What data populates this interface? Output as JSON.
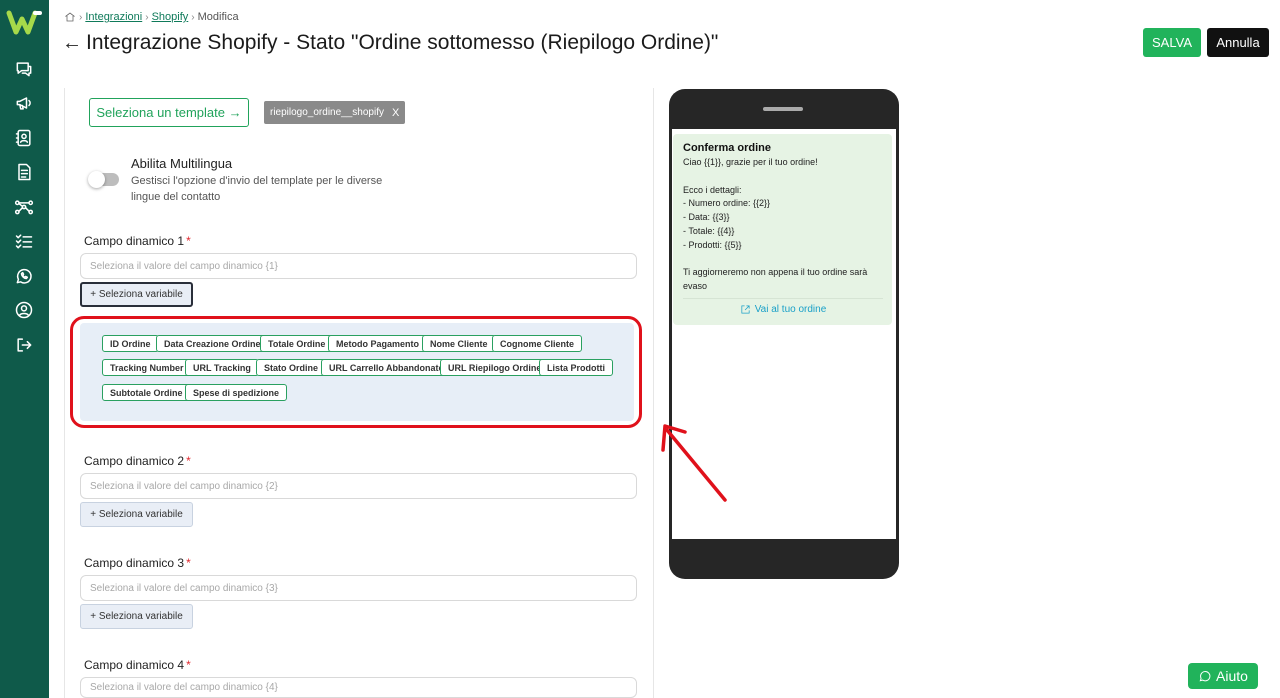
{
  "breadcrumb": {
    "items": [
      "Integrazioni",
      "Shopify",
      "Modifica"
    ]
  },
  "header": {
    "title": "Integrazione Shopify - Stato \"Ordine sottomesso (Riepilogo Ordine)\"",
    "back_glyph": "←",
    "save_label": "SALVA",
    "cancel_label": "Annulla"
  },
  "sidebar": {
    "icons": [
      "chat-icon",
      "megaphone-icon",
      "contacts-icon",
      "document-icon",
      "flow-icon",
      "checklist-icon",
      "whatsapp-icon",
      "user-icon",
      "logout-icon"
    ]
  },
  "template": {
    "select_label": "Seleziona un template",
    "arrow_glyph": "→",
    "selected_name": "riepilogo_ordine__shopify",
    "remove_glyph": "X"
  },
  "multilang": {
    "title": "Abilita Multilingua",
    "description": "Gestisci l'opzione d'invio del template per le diverse lingue del contatto",
    "enabled": false
  },
  "fields": [
    {
      "label": "Campo dinamico 1",
      "required_mark": "*",
      "placeholder": "Seleziona il valore del campo dinamico {1}",
      "button": "+ Seleziona variabile"
    },
    {
      "label": "Campo dinamico 2",
      "required_mark": "*",
      "placeholder": "Seleziona il valore del campo dinamico {2}",
      "button": "+ Seleziona variabile"
    },
    {
      "label": "Campo dinamico 3",
      "required_mark": "*",
      "placeholder": "Seleziona il valore del campo dinamico {3}",
      "button": "+ Seleziona variabile"
    },
    {
      "label": "Campo dinamico 4",
      "required_mark": "*",
      "placeholder": "Seleziona il valore del campo dinamico {4}"
    }
  ],
  "variables": [
    "ID Ordine",
    "Data Creazione Ordine",
    "Totale Ordine",
    "Metodo Pagamento",
    "Nome Cliente",
    "Cognome Cliente",
    "Tracking Number",
    "URL Tracking",
    "Stato Ordine",
    "URL Carrello Abbandonato",
    "URL Riepilogo Ordine",
    "Lista Prodotti",
    "Subtotale Ordine",
    "Spese di spedizione"
  ],
  "preview": {
    "title": "Conferma ordine",
    "body": "Ciao {{1}}, grazie per il tuo ordine!\n\nEcco i dettagli:\n- Numero ordine: {{2}}\n- Data: {{3}}\n- Totale: {{4}}\n- Prodotti: {{5}}\n\nTi aggiorneremo non appena il tuo ordine sarà evaso",
    "button": "Vai al tuo ordine"
  },
  "help": {
    "label": "Aiuto"
  },
  "colors": {
    "sidebar": "#0f5a4a",
    "accent": "#21b35b",
    "highlight": "#e0111b"
  }
}
